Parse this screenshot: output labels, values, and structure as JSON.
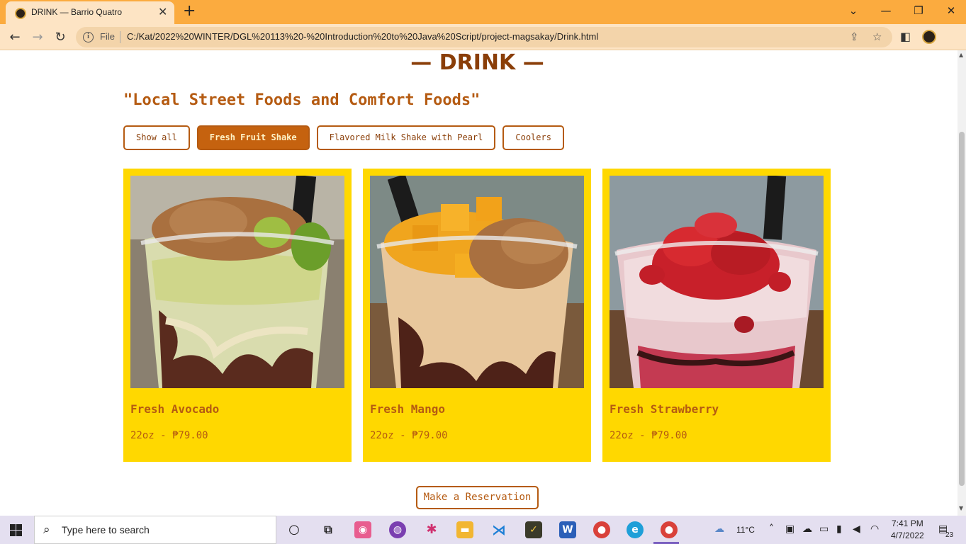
{
  "browser": {
    "tab_title": "DRINK — Barrio Quatro",
    "tab_close": "✕",
    "new_tab": "+",
    "file_label": "File",
    "url": "C:/Kat/2022%20WINTER/DGL%20113%20-%20Introduction%20to%20Java%20Script/project-magsakay/Drink.html",
    "window_controls": [
      "⌄",
      "—",
      "❐",
      "✕"
    ]
  },
  "page": {
    "heading": "— DRINK —",
    "tagline": "\"Local Street Foods and Comfort Foods\"",
    "filters": [
      {
        "label": "Show all",
        "active": false
      },
      {
        "label": "Fresh Fruit Shake",
        "active": true
      },
      {
        "label": "Flavored Milk Shake with Pearl",
        "active": false
      },
      {
        "label": "Coolers",
        "active": false
      }
    ],
    "products": [
      {
        "name": "Fresh Avocado",
        "price": "22oz - ₱79.00"
      },
      {
        "name": "Fresh Mango",
        "price": "22oz - ₱79.00"
      },
      {
        "name": "Fresh Strawberry",
        "price": "22oz - ₱79.00"
      }
    ],
    "reserve_label": "Make a Reservation"
  },
  "taskbar": {
    "search_placeholder": "Type here to search",
    "weather": "11°C",
    "time": "7:41 PM",
    "date": "4/7/2022",
    "notifications": "23"
  },
  "colors": {
    "accent": "#b55b12",
    "heading": "#8a3e08",
    "card_bg": "#ffd800",
    "tab_strip": "#fbab3f"
  }
}
